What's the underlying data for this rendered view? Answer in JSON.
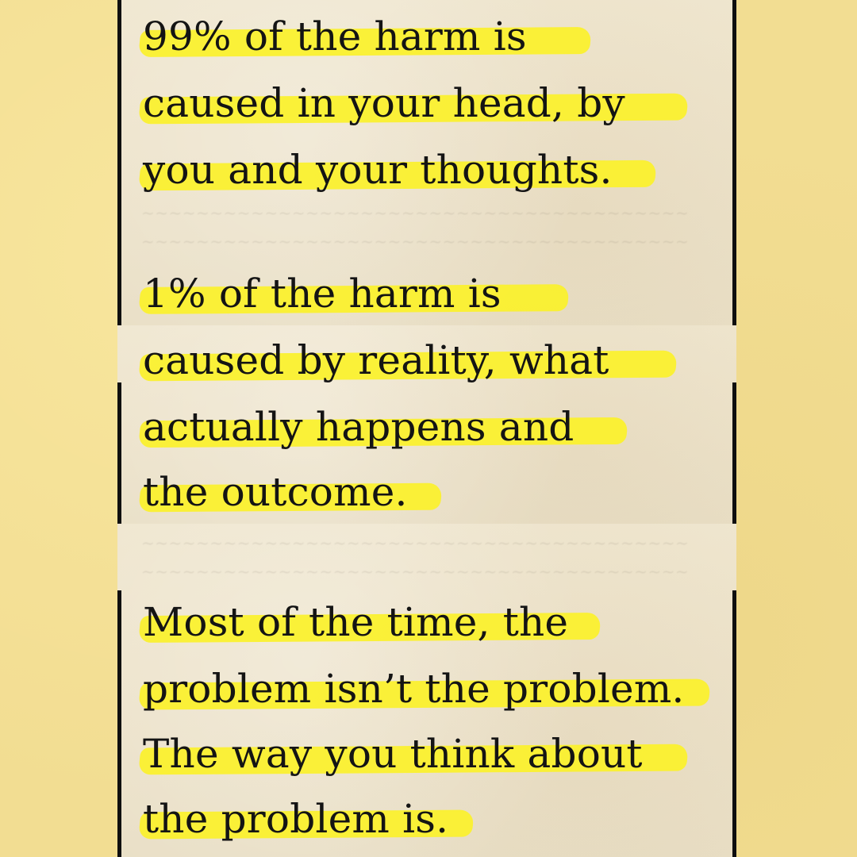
{
  "quote": {
    "block1": {
      "lines": [
        "99% of the harm is",
        "caused in your head, by",
        "you and your thoughts."
      ]
    },
    "block2": {
      "lines": [
        "1% of the harm is",
        "caused by reality, what",
        "actually happens and",
        "the outcome."
      ]
    },
    "block3": {
      "lines": [
        "Most of the time, the",
        "problem isn’t the problem.",
        "The way you think about",
        "the problem is."
      ]
    }
  },
  "colors": {
    "background": "#f2dd92",
    "page": "#ede3cb",
    "highlight": "#fbf12a",
    "ink": "#141414",
    "frame": "#0f0f0f"
  }
}
